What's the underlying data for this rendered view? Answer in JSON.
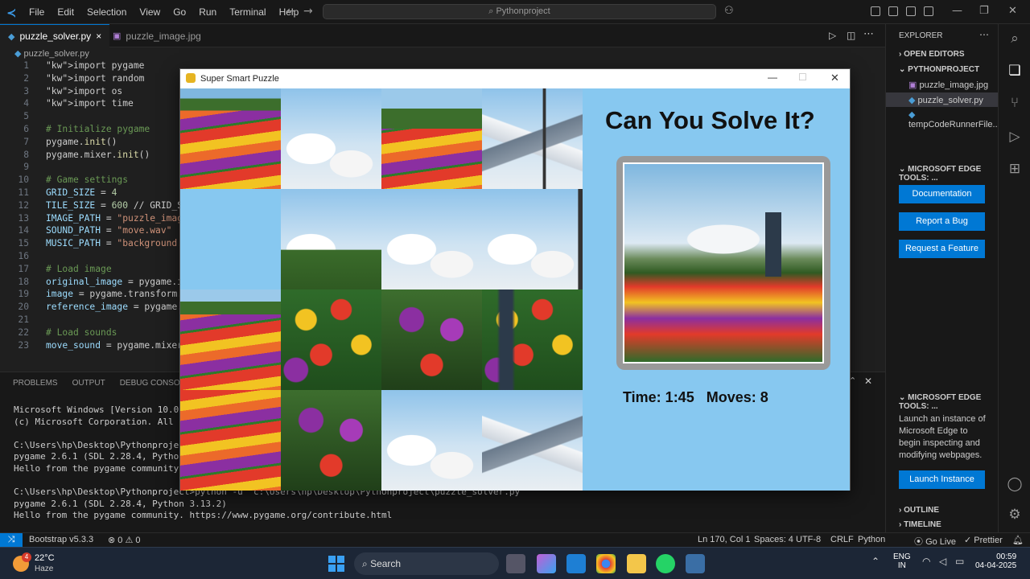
{
  "menu": [
    "File",
    "Edit",
    "Selection",
    "View",
    "Go",
    "Run",
    "Terminal",
    "Help"
  ],
  "search": "Pythonproject",
  "tabs": [
    {
      "label": "puzzle_solver.py",
      "close": "×"
    },
    {
      "label": "puzzle_image.jpg"
    }
  ],
  "breadcrumb": "puzzle_solver.py",
  "code": [
    {
      "n": "1",
      "t": "import pygame"
    },
    {
      "n": "2",
      "t": "import random"
    },
    {
      "n": "3",
      "t": "import os"
    },
    {
      "n": "4",
      "t": "import time"
    },
    {
      "n": "5",
      "t": ""
    },
    {
      "n": "6",
      "t": "# Initialize pygame"
    },
    {
      "n": "7",
      "t": "pygame.init()"
    },
    {
      "n": "8",
      "t": "pygame.mixer.init()"
    },
    {
      "n": "9",
      "t": ""
    },
    {
      "n": "10",
      "t": "# Game settings"
    },
    {
      "n": "11",
      "t": "GRID_SIZE = 4"
    },
    {
      "n": "12",
      "t": "TILE_SIZE = 600 // GRID_SI"
    },
    {
      "n": "13",
      "t": "IMAGE_PATH = \"puzzle_image"
    },
    {
      "n": "14",
      "t": "SOUND_PATH = \"move.wav\""
    },
    {
      "n": "15",
      "t": "MUSIC_PATH = \"background.m"
    },
    {
      "n": "16",
      "t": ""
    },
    {
      "n": "17",
      "t": "# Load image"
    },
    {
      "n": "18",
      "t": "original_image = pygame.im"
    },
    {
      "n": "19",
      "t": "image = pygame.transform.s"
    },
    {
      "n": "20",
      "t": "reference_image = pygame.t"
    },
    {
      "n": "21",
      "t": ""
    },
    {
      "n": "22",
      "t": "# Load sounds"
    },
    {
      "n": "23",
      "t": "move_sound = pygame.mixer."
    }
  ],
  "panel_tabs": [
    "PROBLEMS",
    "OUTPUT",
    "DEBUG CONSOLE"
  ],
  "terminal": [
    "Microsoft Windows [Version 10.0.26",
    "(c) Microsoft Corporation. All rig",
    "",
    "C:\\Users\\hp\\Desktop\\Pythonproject>",
    "pygame 2.6.1 (SDL 2.28.4, Python 3",
    "Hello from the pygame community. ht",
    "",
    "C:\\Users\\hp\\Desktop\\Pythonproject>python -u \"c:\\Users\\hp\\Desktop\\Pythonproject\\puzzle_solver.py\"",
    "pygame 2.6.1 (SDL 2.28.4, Python 3.13.2)",
    "Hello from the pygame community. https://www.pygame.org/contribute.html"
  ],
  "sidebar": {
    "title": "EXPLORER",
    "open_editors": "OPEN EDITORS",
    "project": "PYTHONPROJECT",
    "files": [
      "puzzle_image.jpg",
      "puzzle_solver.py",
      "tempCodeRunnerFile..."
    ],
    "edge_tools": "MICROSOFT EDGE TOOLS: ...",
    "buttons": [
      "Documentation",
      "Report a Bug",
      "Request a Feature"
    ],
    "edge_tools2": "MICROSOFT EDGE TOOLS: ...",
    "edge_desc": "Launch an instance of Microsoft Edge to begin inspecting and modifying webpages.",
    "launch": "Launch Instance",
    "outline": "OUTLINE",
    "timeline": "TIMELINE"
  },
  "status": {
    "bootstrap": "Bootstrap v5.3.3",
    "problems": "⊗ 0 ⚠ 0",
    "position": "Ln 170, Col 1",
    "spaces": "Spaces: 4",
    "encoding": "UTF-8",
    "eol": "CRLF",
    "lang": "Python",
    "golive": "Go Live",
    "prettier": "Prettier"
  },
  "game": {
    "window_title": "Super Smart Puzzle",
    "heading": "Can You Solve It?",
    "time_label": "Time: 1:45",
    "moves_label": "Moves: 8"
  },
  "taskbar": {
    "temp": "22°C",
    "weather": "Haze",
    "badge": "4",
    "search": "Search",
    "lang1": "ENG",
    "lang2": "IN",
    "time": "00:59",
    "date": "04-04-2025"
  },
  "colors": {
    "accent": "#0078d4",
    "game_bg": "#87c8f0"
  }
}
